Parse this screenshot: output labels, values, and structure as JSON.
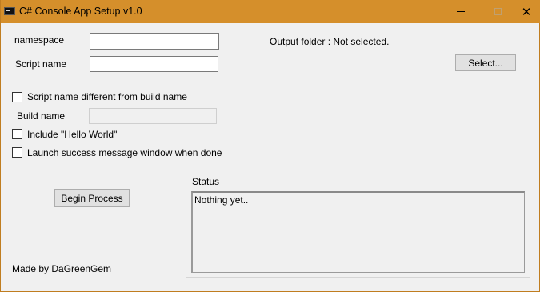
{
  "window": {
    "title": "C# Console App Setup v1.0",
    "icons": {
      "app": "console-app-icon",
      "minimize": "minimize-icon",
      "maximize": "maximize-icon",
      "close": "close-icon"
    },
    "close_glyph": "✕"
  },
  "form": {
    "namespace_label": "namespace",
    "namespace_value": "",
    "script_name_label": "Script name",
    "script_name_value": "",
    "output_folder_text": "Output folder : Not selected.",
    "select_button": "Select...",
    "different_name_checkbox": {
      "label": "Script name different from build name",
      "checked": false
    },
    "build_name_label": "Build name",
    "build_name_value": "",
    "hello_world_checkbox": {
      "label": "Include \"Hello World\"",
      "checked": false
    },
    "launch_message_checkbox": {
      "label": "Launch success message window when done",
      "checked": false
    },
    "begin_button": "Begin Process",
    "footer_text": "Made by DaGreenGem"
  },
  "status": {
    "label": "Status",
    "text": "Nothing yet.."
  },
  "colors": {
    "titlebar": "#d58f2b",
    "background": "#f0f0f0",
    "button": "#e1e1e1"
  }
}
